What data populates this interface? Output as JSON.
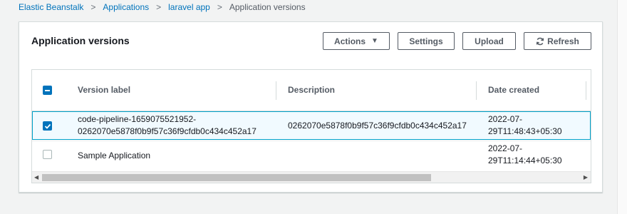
{
  "breadcrumb": {
    "items": [
      "Elastic Beanstalk",
      "Applications",
      "laravel app"
    ],
    "current": "Application versions",
    "separator": ">"
  },
  "panel": {
    "title": "Application versions",
    "buttons": {
      "actions": "Actions",
      "settings": "Settings",
      "upload": "Upload",
      "refresh": "Refresh"
    }
  },
  "table": {
    "columns": [
      "Version label",
      "Description",
      "Date created"
    ],
    "rows": [
      {
        "selected": true,
        "label_line1": "code-pipeline-1659075521952-",
        "label_line2": "0262070e5878f0b9f57c36f9cfdb0c434c452a17",
        "description": "0262070e5878f0b9f57c36f9cfdb0c434c452a17",
        "date_line1": "2022-07-",
        "date_line2": "29T11:48:43+05:30"
      },
      {
        "selected": false,
        "label_line1": "Sample Application",
        "label_line2": "",
        "description": "",
        "date_line1": "2022-07-",
        "date_line2": "29T11:14:44+05:30"
      }
    ]
  },
  "colors": {
    "link": "#0073bb",
    "selected_bg": "#f1faff",
    "selected_border": "#00a1c9",
    "checkbox_fill": "#0073bb"
  }
}
